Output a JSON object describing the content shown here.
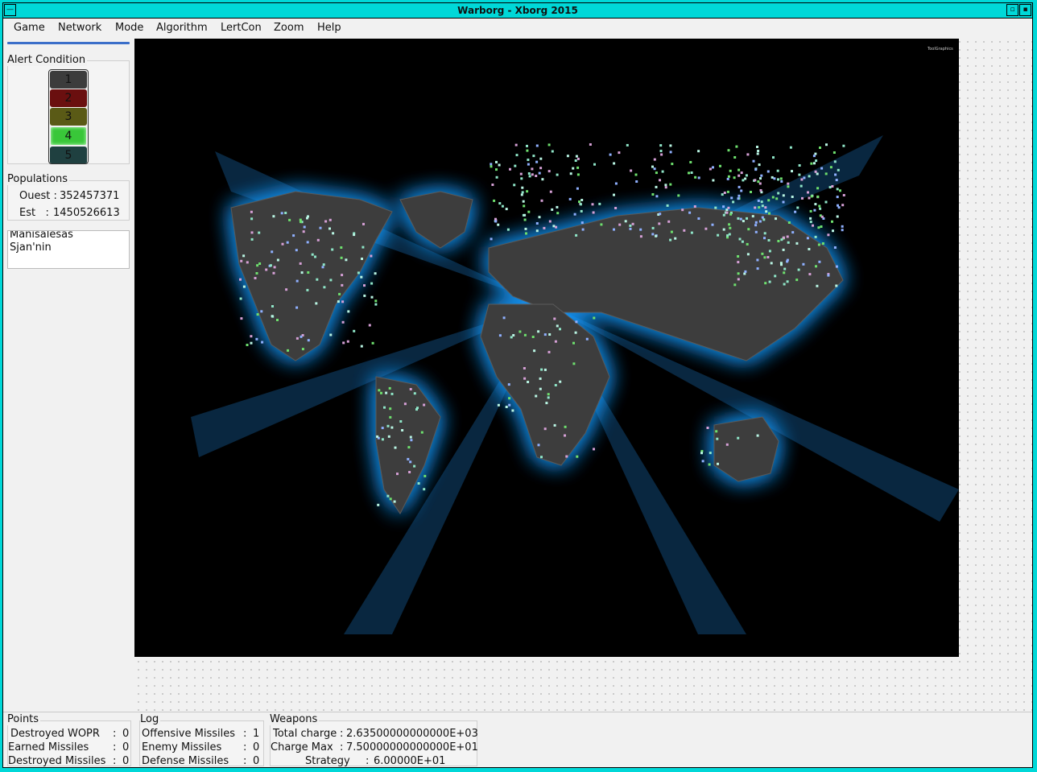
{
  "window": {
    "title": "Warborg - Xborg 2015"
  },
  "menu": [
    "Game",
    "Network",
    "Mode",
    "Algorithm",
    "LertCon",
    "Zoom",
    "Help"
  ],
  "alert": {
    "label": "Alert Condition",
    "levels": [
      {
        "n": "1",
        "color": "#3c3c3c"
      },
      {
        "n": "2",
        "color": "#6a0f0f"
      },
      {
        "n": "3",
        "color": "#5a5a16"
      },
      {
        "n": "4",
        "color": "#39c739"
      },
      {
        "n": "5",
        "color": "#1f4040"
      }
    ],
    "active": "4"
  },
  "populations": {
    "label": "Populations",
    "ouest_label": "Ouest :",
    "ouest": "352457371",
    "est_label": "Est   :",
    "est": "1450526613"
  },
  "names": [
    "Manisalesas",
    "Sjan'nin"
  ],
  "map": {
    "logo": "ToolGraphics"
  },
  "points": {
    "label": "Points",
    "rows": [
      {
        "k": "Destroyed WOPR",
        "v": "0"
      },
      {
        "k": "Earned Missiles",
        "v": "0"
      },
      {
        "k": "Destroyed Missiles",
        "v": "0"
      }
    ]
  },
  "log": {
    "label": "Log",
    "rows": [
      {
        "k": "Offensive Missiles",
        "v": "1"
      },
      {
        "k": "Enemy Missiles",
        "v": "0"
      },
      {
        "k": "Defense Missiles",
        "v": "0"
      }
    ]
  },
  "weapons": {
    "label": "Weapons",
    "rows": [
      {
        "k": "Total charge",
        "v": "2.63500000000000E+03"
      },
      {
        "k": "Charge Max",
        "v": "7.50000000000000E+01"
      },
      {
        "k": "Strategy",
        "v": "6.00000E+01"
      }
    ]
  },
  "colors": {
    "accent": "#3b6fc9",
    "titlebar": "#00d8d8",
    "glow": "#1e9bff",
    "land": "#3d3d3d"
  }
}
